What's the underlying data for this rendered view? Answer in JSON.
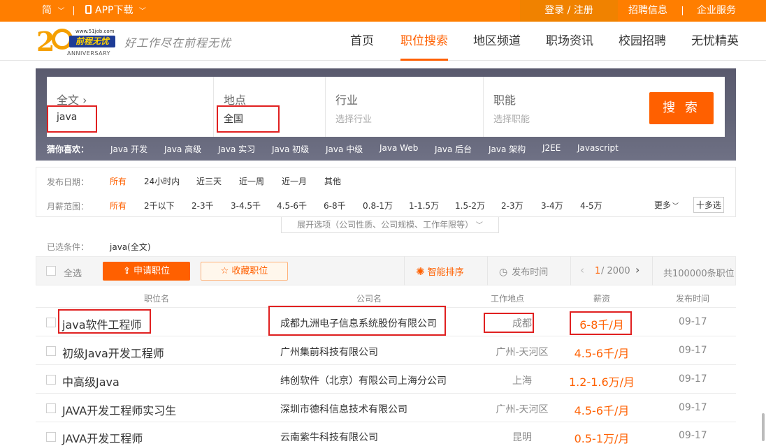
{
  "topbar": {
    "lang": "简",
    "app_download": "APP下载",
    "login": "登录 / 注册",
    "recruit": "招聘信息",
    "enterprise": "企业服务"
  },
  "logo": {
    "domain": "www.51job.com",
    "brand": "前程无忧",
    "anniversary": "ANNIVERSARY",
    "slogan": "好工作尽在前程无忧"
  },
  "nav": [
    "首页",
    "职位搜索",
    "地区频道",
    "职场资讯",
    "校园招聘",
    "无忧精英"
  ],
  "nav_active_index": 1,
  "search": {
    "fulltext_label": "全文",
    "fulltext_value": "java",
    "location_label": "地点",
    "location_value": "全国",
    "industry_label": "行业",
    "industry_placeholder": "选择行业",
    "function_label": "职能",
    "function_placeholder": "选择职能",
    "button": "搜 索"
  },
  "guess": {
    "label": "猜你喜欢：",
    "items": [
      "Java 开发",
      "Java 高级",
      "Java 实习",
      "Java 初级",
      "Java 中级",
      "Java Web",
      "Java 后台",
      "Java 架构",
      "J2EE",
      "Javascript"
    ]
  },
  "filters": {
    "date_label": "发布日期：",
    "date_options": [
      "所有",
      "24小时内",
      "近三天",
      "近一周",
      "近一月",
      "其他"
    ],
    "salary_label": "月薪范围：",
    "salary_options": [
      "所有",
      "2千以下",
      "2-3千",
      "3-4.5千",
      "4.5-6千",
      "6-8千",
      "0.8-1万",
      "1-1.5万",
      "1.5-2万",
      "2-3万",
      "3-4万",
      "4-5万"
    ],
    "more": "更多",
    "multi": "十多选",
    "expand": "展开选项（公司性质、公司规模、工作年限等）"
  },
  "selected": {
    "label": "已选条件：",
    "value": "java(全文)"
  },
  "toolbar": {
    "select_all": "全选",
    "apply": "申请职位",
    "favorite": "收藏职位",
    "smart_sort": "智能排序",
    "time_sort": "发布时间",
    "page_current": "1",
    "page_total": "/ 2000",
    "total": "共100000条职位"
  },
  "table": {
    "headers": [
      "职位名",
      "公司名",
      "工作地点",
      "薪资",
      "发布时间"
    ],
    "rows": [
      {
        "job": "java软件工程师",
        "company": "成都九洲电子信息系统股份有限公司",
        "location": "成都",
        "salary": "6-8千/月",
        "date": "09-17"
      },
      {
        "job": "初级Java开发工程师",
        "company": "广州集前科技有限公司",
        "location": "广州-天河区",
        "salary": "4.5-6千/月",
        "date": "09-17"
      },
      {
        "job": "中高级Java",
        "company": "纬创软件（北京）有限公司上海分公司",
        "location": "上海",
        "salary": "1.2-1.6万/月",
        "date": "09-17"
      },
      {
        "job": "JAVA开发工程师实习生",
        "company": "深圳市德科信息技术有限公司",
        "location": "广州-天河区",
        "salary": "4.5-6千/月",
        "date": "09-17"
      },
      {
        "job": "JAVA开发工程师",
        "company": "云南紫牛科技有限公司",
        "location": "昆明",
        "salary": "0.5-1万/月",
        "date": "09-17"
      }
    ]
  },
  "colors": {
    "brand_orange": "#ff7e00",
    "accent": "#ff6000",
    "highlight_box": "#e02020"
  }
}
